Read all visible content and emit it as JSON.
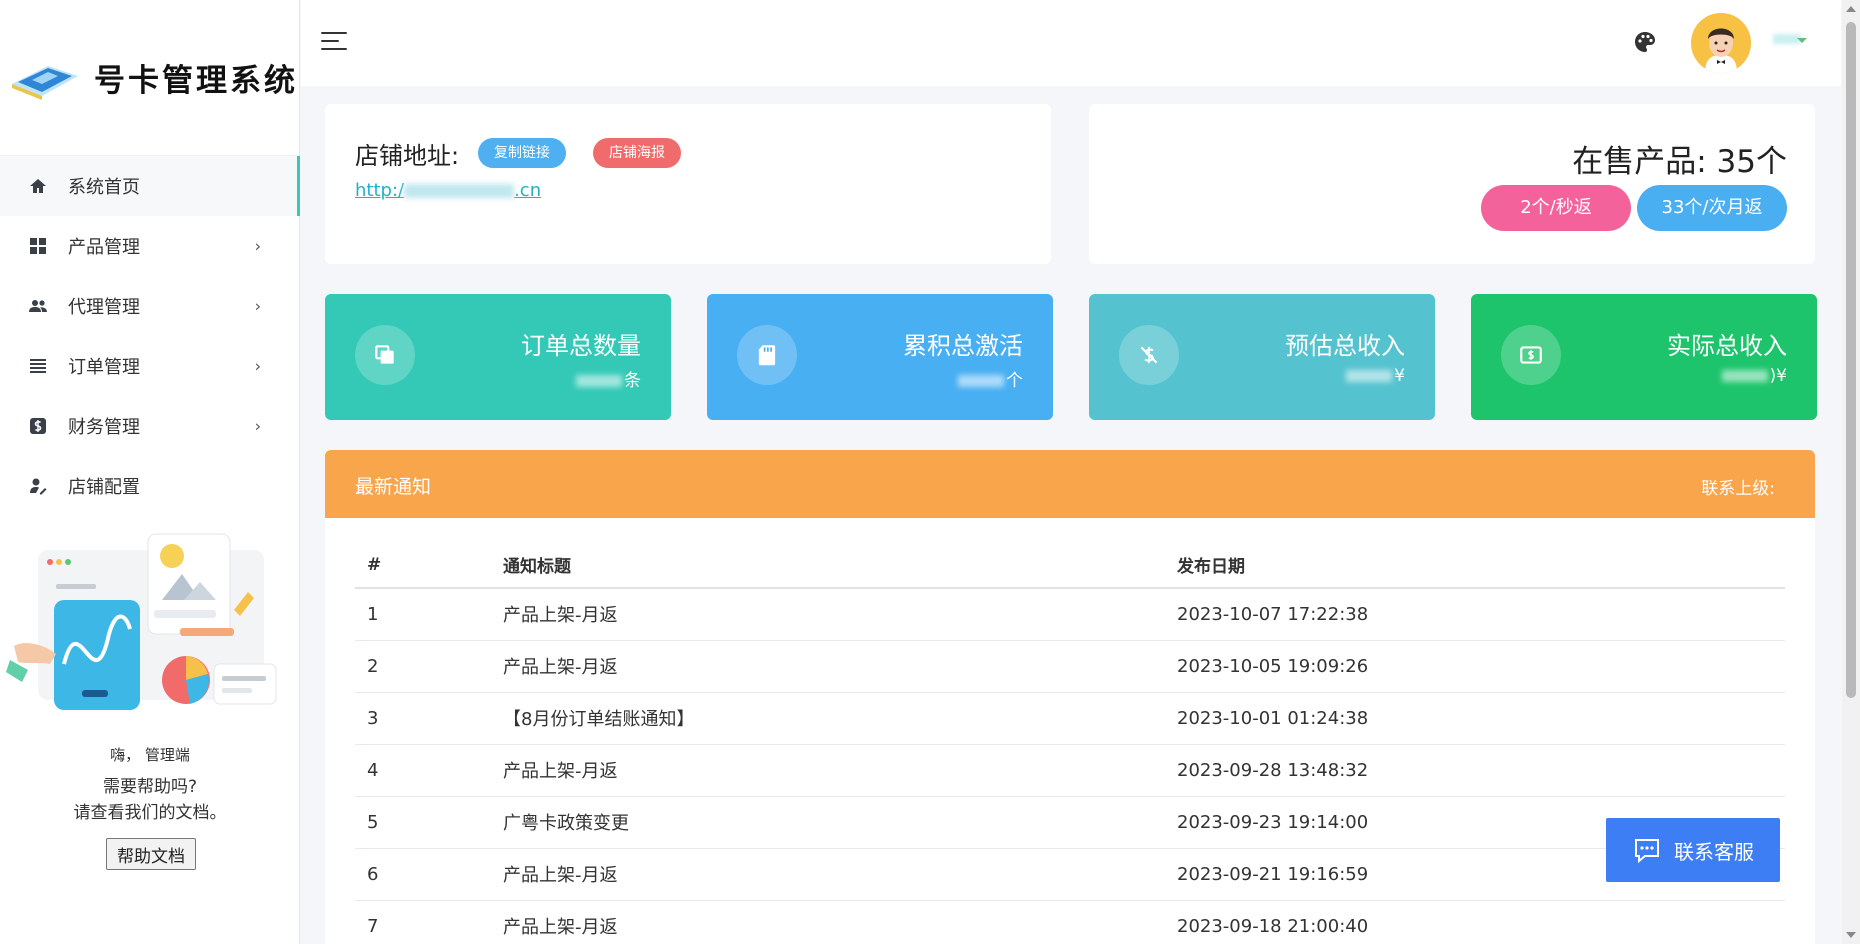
{
  "brand": {
    "title": "号卡管理系统"
  },
  "sidebar": {
    "items": [
      {
        "label": "系统首页",
        "icon": "home-icon",
        "active": true,
        "has_children": false
      },
      {
        "label": "产品管理",
        "icon": "grid-icon",
        "active": false,
        "has_children": true
      },
      {
        "label": "代理管理",
        "icon": "users-icon",
        "active": false,
        "has_children": true
      },
      {
        "label": "订单管理",
        "icon": "list-icon",
        "active": false,
        "has_children": true
      },
      {
        "label": "财务管理",
        "icon": "dollar-icon",
        "active": false,
        "has_children": true
      },
      {
        "label": "店铺配置",
        "icon": "user-edit-icon",
        "active": false,
        "has_children": false
      }
    ],
    "chevron": "›",
    "help": {
      "greeting": "嗨， 管理端",
      "question_line1": "需要帮助吗?",
      "question_line2": "请查看我们的文档。",
      "button_label": "帮助文档"
    }
  },
  "header": {
    "palette_icon": "palette-icon",
    "avatar": "avatar"
  },
  "shop": {
    "label": "店铺地址:",
    "copy_link": "复制链接",
    "poster": "店铺海报",
    "url_prefix": "http:/",
    "url_suffix": ".cn"
  },
  "products": {
    "title": "在售产品:   35个",
    "instant": "2个/秒返",
    "monthly": "33个/次月返"
  },
  "stats": [
    {
      "label": "订单总数量",
      "unit": "条",
      "icon": "copy-icon"
    },
    {
      "label": "累积总激活",
      "unit": "个",
      "icon": "sd-card-icon"
    },
    {
      "label": "预估总收入",
      "unit": "¥",
      "icon": "dollar-slash-icon"
    },
    {
      "label": "实际总收入",
      "unit": ")¥",
      "icon": "money-icon"
    }
  ],
  "notices": {
    "title": "最新通知",
    "contact": "联系上级:",
    "columns": [
      "#",
      "通知标题",
      "发布日期"
    ],
    "rows": [
      {
        "no": "1",
        "title": "产品上架-月返",
        "date": "2023-10-07 17:22:38"
      },
      {
        "no": "2",
        "title": "产品上架-月返",
        "date": "2023-10-05 19:09:26"
      },
      {
        "no": "3",
        "title": "【8月份订单结账通知】",
        "date": "2023-10-01 01:24:38"
      },
      {
        "no": "4",
        "title": "产品上架-月返",
        "date": "2023-09-28 13:48:32"
      },
      {
        "no": "5",
        "title": "广粤卡政策变更",
        "date": "2023-09-23 19:14:00"
      },
      {
        "no": "6",
        "title": "产品上架-月返",
        "date": "2023-09-21 19:16:59"
      },
      {
        "no": "7",
        "title": "产品上架-月返",
        "date": "2023-09-18 21:00:40"
      }
    ]
  },
  "support": {
    "label": "联系客服"
  },
  "colors": {
    "accent": "#34c9b7",
    "orange": "#f8a54b",
    "blue": "#49aff3",
    "green": "#1dc46c",
    "pink": "#f3629a"
  }
}
